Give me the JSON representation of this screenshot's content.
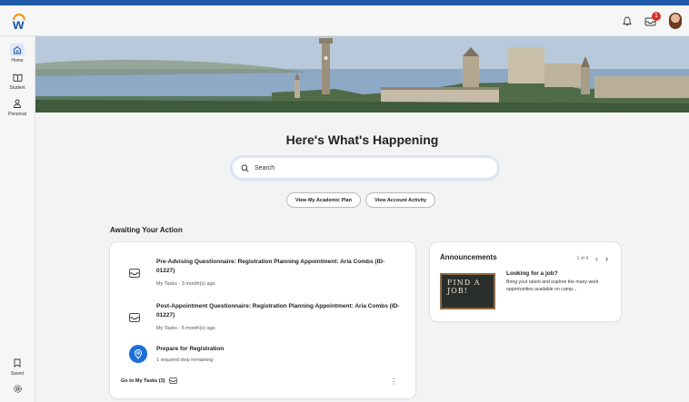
{
  "colors": {
    "accent": "#1e5aa8",
    "notification": "#d9322b",
    "pin": "#1d6fd8"
  },
  "header": {
    "logo_letter": "w",
    "notification_count": "1",
    "icons": [
      "bell-icon",
      "inbox-icon",
      "avatar"
    ]
  },
  "sidebar": {
    "items": [
      {
        "label": "Home",
        "icon": "home-icon"
      },
      {
        "label": "Student",
        "icon": "book-icon"
      },
      {
        "label": "Personal",
        "icon": "person-icon"
      }
    ],
    "bottom": [
      {
        "label": "Saved",
        "icon": "bookmark-icon"
      },
      {
        "label": "",
        "icon": "gear-icon"
      }
    ]
  },
  "main": {
    "title": "Here's What's Happening",
    "search_placeholder": "Search",
    "buttons": [
      "View My Academic Plan",
      "View Account Activity"
    ],
    "awaiting_heading": "Awaiting Your Action"
  },
  "tasks": {
    "items": [
      {
        "title": "Pre-Advising Questionnaire: Registration Planning Appointment: Aria Combs (ID-01227)",
        "subtitle": "My Tasks - 3 month(s) ago",
        "icon": "inbox-icon"
      },
      {
        "title": "Post-Appointment Questionnaire: Registration Planning Appointment: Aria Combs (ID-01227)",
        "subtitle": "My Tasks - 5 month(s) ago",
        "icon": "inbox-icon"
      },
      {
        "title": "Prepare for Registration",
        "subtitle": "1 required step remaining",
        "icon": "location-pin-icon"
      }
    ],
    "goto_label": "Go to My Tasks (3)"
  },
  "announcements": {
    "heading": "Announcements",
    "pager": "1 of 4",
    "image_text_line1": "FIND A",
    "image_text_line2": "JOB!",
    "item_title": "Looking for a job?",
    "item_body": "Bring your talent and explore the many work opportunities available on camp..."
  }
}
